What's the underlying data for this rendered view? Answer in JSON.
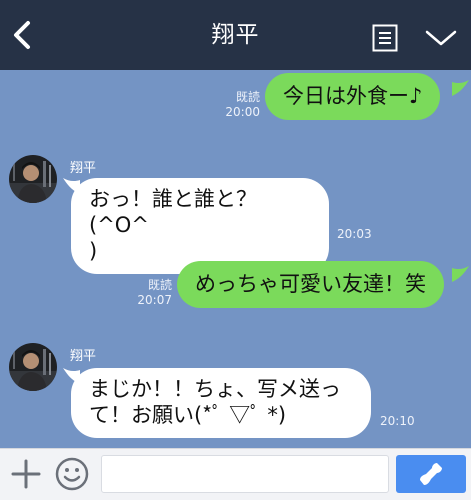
{
  "header": {
    "title": "翔平"
  },
  "messages": [
    {
      "type": "outgoing",
      "text": "今日は外食ー♪",
      "read": "既読",
      "time": "20:00"
    },
    {
      "type": "incoming",
      "sender": "翔平",
      "lines": [
        "おっ！誰と誰と？(^O^",
        ")"
      ],
      "time": "20:03"
    },
    {
      "type": "outgoing",
      "text": "めっちゃ可愛い友達！笑",
      "read": "既読",
      "time": "20:07"
    },
    {
      "type": "incoming",
      "sender": "翔平",
      "lines": [
        "まじか！！ちょ、写メ送っ",
        "て！お願い(*ﾟ ▽ﾟ *)"
      ],
      "time": "20:10"
    }
  ],
  "input": {
    "value": "",
    "placeholder": ""
  },
  "colors": {
    "header_bg": "#263246",
    "chat_bg": "#7494c4",
    "outgoing_bubble": "#7bda5b",
    "incoming_bubble": "#ffffff",
    "send_button": "#4a8df0"
  },
  "icons": [
    "back-arrow-icon",
    "notes-icon",
    "chevron-down-icon",
    "plus-icon",
    "emoji-icon",
    "send-icon"
  ]
}
